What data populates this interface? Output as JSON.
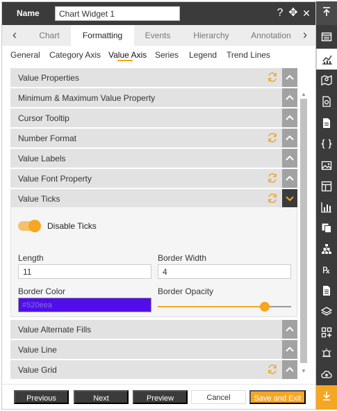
{
  "header": {
    "name_label": "Name",
    "name_value": "Chart Widget 1",
    "help_icon": "?",
    "move_icon": "✥",
    "close_icon": "✕"
  },
  "tabs": {
    "prev_icon": "‹",
    "next_icon": "›",
    "items": [
      "Chart",
      "Formatting",
      "Events",
      "Hierarchy",
      "Annotation"
    ],
    "active": "Formatting"
  },
  "subtabs": {
    "items": [
      "General",
      "Category Axis",
      "Value Axis",
      "Series",
      "Legend",
      "Trend Lines"
    ],
    "active": "Value Axis"
  },
  "sections": [
    {
      "label": "Value Properties",
      "has_reset": true,
      "expanded": false
    },
    {
      "label": "Minimum & Maximum Value Property",
      "has_reset": false,
      "expanded": false
    },
    {
      "label": "Cursor Tooltip",
      "has_reset": false,
      "expanded": false
    },
    {
      "label": "Number Format",
      "has_reset": true,
      "expanded": false
    },
    {
      "label": "Value Labels",
      "has_reset": false,
      "expanded": false
    },
    {
      "label": "Value Font Property",
      "has_reset": true,
      "expanded": false
    },
    {
      "label": "Value Ticks",
      "has_reset": true,
      "expanded": true
    },
    {
      "label": "Value Alternate Fills",
      "has_reset": false,
      "expanded": false
    },
    {
      "label": "Value Line",
      "has_reset": false,
      "expanded": false
    },
    {
      "label": "Value Grid",
      "has_reset": true,
      "expanded": false
    }
  ],
  "value_ticks": {
    "disable_ticks_label": "Disable Ticks",
    "disable_ticks_on": true,
    "length_label": "Length",
    "length_value": "11",
    "border_width_label": "Border Width",
    "border_width_value": "4",
    "border_color_label": "Border Color",
    "border_color_value": "#520eea",
    "border_opacity_label": "Border Opacity",
    "border_opacity_fraction": 0.8
  },
  "footer": {
    "previous": "Previous",
    "next": "Next",
    "preview": "Preview",
    "cancel": "Cancel",
    "save_exit": "Save and Exit"
  },
  "colors": {
    "accent": "#f5a623",
    "dark": "#3b3b3b",
    "section_bg": "#e2e2e2",
    "border_color_swatch": "#520eea"
  },
  "toolbar_icons": [
    "collapse-up-icon",
    "properties-icon",
    "chart-icon",
    "map-icon",
    "script-file-icon",
    "document-icon",
    "braces-icon",
    "image-icon",
    "layout-icon",
    "bar-chart-icon",
    "copy-icon",
    "hierarchy-icon",
    "rx-icon",
    "text-file-icon",
    "layers-icon",
    "add-widget-icon",
    "alert-icon",
    "cloud-upload-icon",
    "expand-down-icon"
  ]
}
